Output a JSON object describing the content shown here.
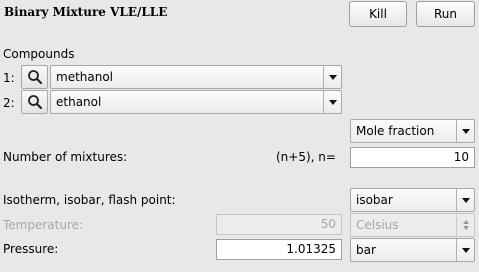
{
  "window": {
    "title": "Binary Mixture VLE/LLE"
  },
  "toolbar": {
    "kill_label": "Kill",
    "run_label": "Run"
  },
  "compounds": {
    "section_label": "Compounds",
    "items": [
      {
        "index_label": "1:",
        "name": "methanol",
        "search_icon": "search-icon"
      },
      {
        "index_label": "2:",
        "name": "ethanol",
        "search_icon": "search-icon"
      }
    ]
  },
  "composition_unit": {
    "selected": "Mole fraction"
  },
  "mixtures": {
    "label": "Number of mixtures:",
    "formula_label": "(n+5), n=",
    "value": "10"
  },
  "mode": {
    "label": "Isotherm, isobar, flash point:",
    "selected": "isobar"
  },
  "temperature": {
    "label": "Temperature:",
    "value": "50",
    "unit": "Celsius",
    "enabled": false
  },
  "pressure": {
    "label": "Pressure:",
    "value": "1.01325",
    "unit": "bar"
  }
}
